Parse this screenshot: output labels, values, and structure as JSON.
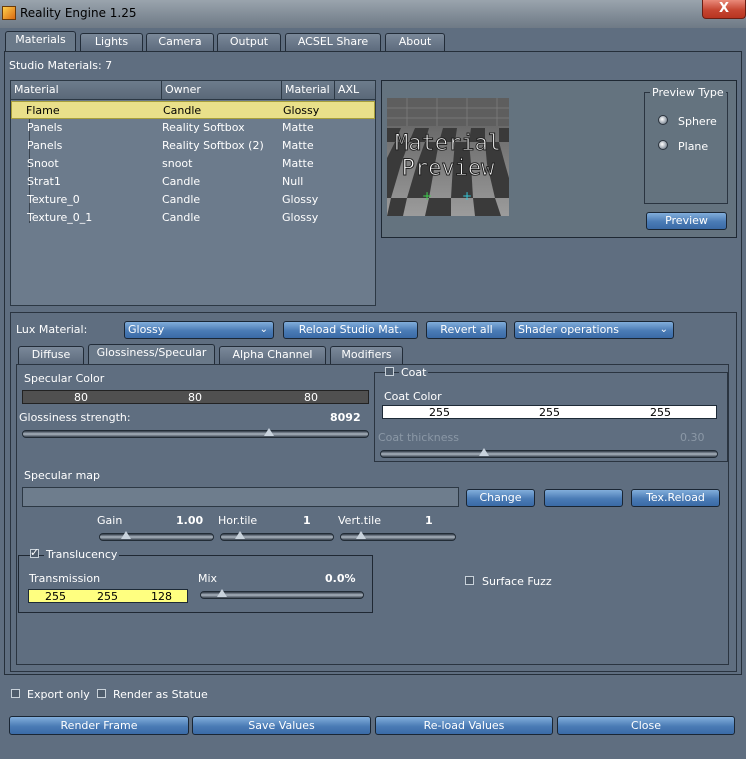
{
  "window": {
    "title": "Reality Engine 1.25",
    "close_label": "X"
  },
  "tabs": [
    "Materials",
    "Lights",
    "Camera",
    "Output",
    "ACSEL Share",
    "About"
  ],
  "studio_materials_label": "Studio Materials: 7",
  "table": {
    "columns": [
      "Material",
      "Owner",
      "Material",
      "AXL"
    ],
    "rows": [
      [
        "Flame",
        "Candle",
        "Glossy"
      ],
      [
        "Panels",
        "Reality Softbox",
        "Matte"
      ],
      [
        "Panels",
        "Reality Softbox (2)",
        "Matte"
      ],
      [
        "Snoot",
        "snoot",
        "Matte"
      ],
      [
        "Strat1",
        "Candle",
        "Null"
      ],
      [
        "Texture_0",
        "Candle",
        "Glossy"
      ],
      [
        "Texture_0_1",
        "Candle",
        "Glossy"
      ]
    ]
  },
  "preview": {
    "image_text_1": "Material",
    "image_text_2": "Preview",
    "type_label": "Preview Type",
    "options": [
      "Sphere",
      "Plane"
    ],
    "button": "Preview"
  },
  "lux": {
    "label": "Lux Material:",
    "value": "Glossy",
    "reload_button": "Reload Studio Mat.",
    "revert_button": "Revert all",
    "shader_ops": "Shader operations"
  },
  "subtabs": [
    "Diffuse",
    "Glossiness/Specular",
    "Alpha Channel",
    "Modifiers"
  ],
  "specular": {
    "color_label": "Specular Color",
    "color_values": [
      "80",
      "80",
      "80"
    ],
    "glossiness_label": "Glossiness strength:",
    "glossiness_value": "8092",
    "glossiness_fraction": 0.72
  },
  "coat": {
    "label": "Coat",
    "color_label": "Coat Color",
    "color_values": [
      "255",
      "255",
      "255"
    ],
    "thickness_label": "Coat thickness",
    "thickness_value": "0.30",
    "thickness_fraction": 0.3
  },
  "specular_map": {
    "label": "Specular map",
    "change_button": "Change",
    "disabled_button": "",
    "reload_button": "Tex.Reload",
    "gain_label": "Gain",
    "gain_value": "1.00",
    "hortile_label": "Hor.tile",
    "hortile_value": "1",
    "verttile_label": "Vert.tile",
    "verttile_value": "1"
  },
  "translucency": {
    "label": "Translucency",
    "transmission_label": "Transmission",
    "transmission_values": [
      "255",
      "255",
      "128"
    ],
    "mix_label": "Mix",
    "mix_value": "0.0%",
    "surface_fuzz_label": "Surface Fuzz"
  },
  "footer": {
    "export_only": "Export only",
    "render_statue": "Render as Statue",
    "buttons": [
      "Render Frame",
      "Save Values",
      "Re-load Values",
      "Close"
    ]
  }
}
